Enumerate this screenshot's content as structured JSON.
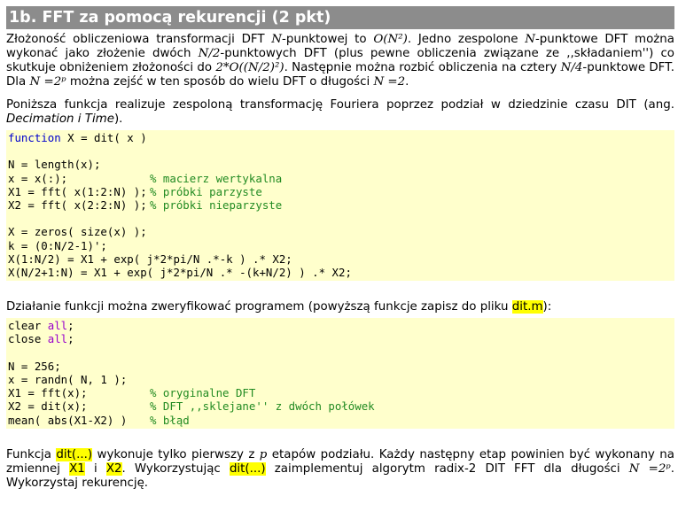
{
  "section": {
    "title": "1b. FFT za pomocą rekurencji (2 pkt)"
  },
  "intro": {
    "t1": "Złożoność obliczeniowa transformacji DFT ",
    "N": "N",
    "t2": "-punktowej to ",
    "O1": "O(N²)",
    "t3": ". Jedno zespolone ",
    "N2": "N",
    "t4": "-punktowe DFT można wykonać jako złożenie dwóch ",
    "N2half": "N/2",
    "t5": "-punktowych DFT (plus pewne obliczenia związane ze ,,składaniem'') co skutkuje obniżeniem złożoności do ",
    "O2": "2*O((N/2)²)",
    "t6": ". Następnie można rozbić obliczenia na cztery ",
    "N4": "N/4",
    "t7": "-punktowe DFT. Dla ",
    "Ndef": "N =2ᵖ",
    "t8": " można zejść w ten sposób do wielu DFT o długości ",
    "N2eq": "N =2",
    "t9": "."
  },
  "desc": {
    "t1": "Poniższa funkcja realizuje zespoloną transformację Fouriera poprzez podział w dziedzinie czasu DIT (ang. ",
    "em": "Decimation i Time",
    "t2": ")."
  },
  "code1": {
    "kw": "function",
    "sig": " X = dit( x )",
    "l1": "N = length(x);",
    "l2": "x = x(:);",
    "c2": "% macierz wertykalna",
    "l3": "X1 = fft( x(1:2:N) );",
    "c3": "% próbki parzyste",
    "l4": "X2 = fft( x(2:2:N) );",
    "c4": "% próbki nieparzyste",
    "l5": "X = zeros( size(x) );",
    "l6": "k = (0:N/2-1)';",
    "l7": "X(1:N/2) = X1 + exp( j*2*pi/N .*-k ) .* X2;",
    "l8": "X(N/2+1:N) = X1 + exp( j*2*pi/N .* -(k+N/2) ) .* X2;"
  },
  "verify": {
    "t1": "Działanie funkcji można zweryfikować programem (powyższą funkcje zapisz do pliku ",
    "file": "dit.m",
    "t2": "):"
  },
  "code2": {
    "l1a": "clear ",
    "l1b": "all",
    "l1c": ";",
    "l2a": "close ",
    "l2b": "all",
    "l2c": ";",
    "l3": "N = 256;",
    "l4": "x = randn( N, 1 );",
    "l5": "X1 = fft(x);",
    "c5": "% oryginalne DFT",
    "l6": "X2 = dit(x);",
    "c6": "% DFT ,,sklejane'' z dwóch połówek",
    "l7": "mean( abs(X1-X2) )",
    "c7": "% błąd"
  },
  "task": {
    "t1": "Funkcja ",
    "h1": "dit(...)",
    "t2": " wykonuje tylko pierwszy z ",
    "p": "p",
    "t3": " etapów podziału. Każdy następny etap powinien być wykonany na zmiennej ",
    "h2": "X1",
    "t4": " i ",
    "h3": "X2",
    "t5": ". Wykorzystując ",
    "h4": "dit(...)",
    "t6": " zaimplementuj algorytm radix-2 DIT FFT dla długości ",
    "Ndef": "N =2ᵖ",
    "t7": ". Wykorzystaj rekurencję."
  }
}
